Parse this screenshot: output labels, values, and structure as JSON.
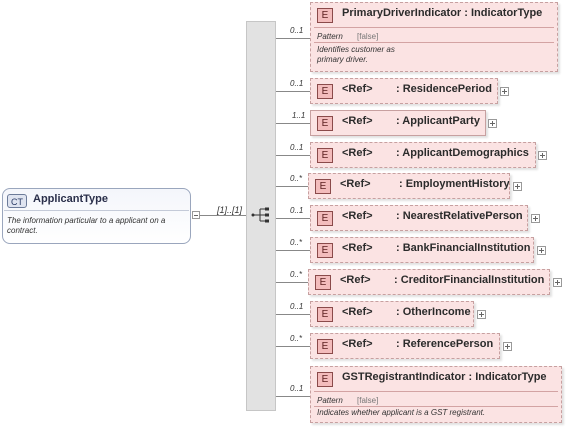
{
  "complex_type": {
    "badge": "CT",
    "name": "ApplicantType",
    "documentation": "The information particular to a applicant on a contract."
  },
  "sequence": {
    "cardinality": "[1]..[1]"
  },
  "elements": [
    {
      "badge": "E",
      "cardinality": "0..1",
      "name": "PrimaryDriverIndicator : IndicatorType",
      "facet_label": "Pattern",
      "facet_value": "[false]",
      "doc_line1": "Identifies customer as",
      "doc_line2": "primary driver."
    },
    {
      "badge": "E",
      "cardinality": "0..1",
      "ref": "<Ref>",
      "name": ": ResidencePeriod"
    },
    {
      "badge": "E",
      "cardinality": "1..1",
      "ref": "<Ref>",
      "name": ": ApplicantParty"
    },
    {
      "badge": "E",
      "cardinality": "0..1",
      "ref": "<Ref>",
      "name": ": ApplicantDemographics"
    },
    {
      "badge": "E",
      "cardinality": "0..*",
      "ref": "<Ref>",
      "name": ": EmploymentHistory"
    },
    {
      "badge": "E",
      "cardinality": "0..1",
      "ref": "<Ref>",
      "name": ": NearestRelativePerson"
    },
    {
      "badge": "E",
      "cardinality": "0..*",
      "ref": "<Ref>",
      "name": ": BankFinancialInstitution"
    },
    {
      "badge": "E",
      "cardinality": "0..*",
      "ref": "<Ref>",
      "name": ": CreditorFinancialInstitution"
    },
    {
      "badge": "E",
      "cardinality": "0..1",
      "ref": "<Ref>",
      "name": ": OtherIncome"
    },
    {
      "badge": "E",
      "cardinality": "0..*",
      "ref": "<Ref>",
      "name": ": ReferencePerson"
    },
    {
      "badge": "E",
      "cardinality": "0..1",
      "name": "GSTRegistrantIndicator : IndicatorType",
      "facet_label": "Pattern",
      "facet_value": "[false]",
      "doc_line1": "Indicates whether applicant is a GST registrant."
    }
  ]
}
